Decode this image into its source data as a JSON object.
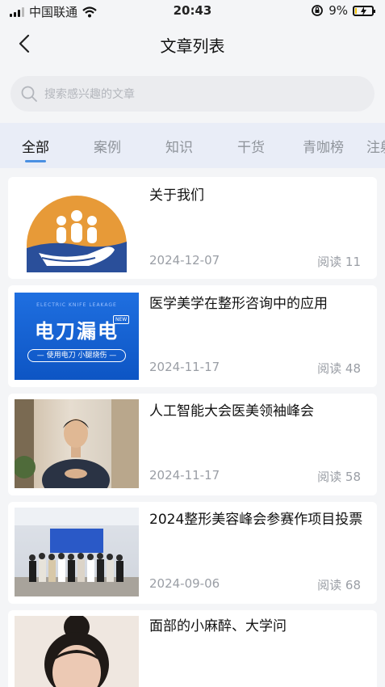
{
  "status_bar": {
    "carrier": "中国联通",
    "time": "20:43",
    "battery": "9%",
    "battery_level": 0.09
  },
  "nav": {
    "title": "文章列表"
  },
  "search": {
    "placeholder": "搜索感兴趣的文章"
  },
  "tabs": [
    "全部",
    "案例",
    "知识",
    "干货",
    "青咖榜",
    "注射"
  ],
  "articles": [
    {
      "title": "关于我们",
      "date": "2024-12-07",
      "reads": "阅读 11"
    },
    {
      "title": "医学美学在整形咨询中的应用",
      "date": "2024-11-17",
      "reads": "阅读 48",
      "thumb_text": {
        "main": "电刀漏电",
        "sub": "— 使用电刀 小腿烧伤 —",
        "top": "ELECTRIC KNIFE LEAKAGE",
        "badge": "NEW"
      }
    },
    {
      "title": "人工智能大会医美领袖峰会",
      "date": "2024-11-17",
      "reads": "阅读 58"
    },
    {
      "title": "2024整形美容峰会参赛作项目投票",
      "date": "2024-09-06",
      "reads": "阅读 68"
    },
    {
      "title": "面部的小麻醉、大学问",
      "date": "",
      "reads": ""
    }
  ]
}
